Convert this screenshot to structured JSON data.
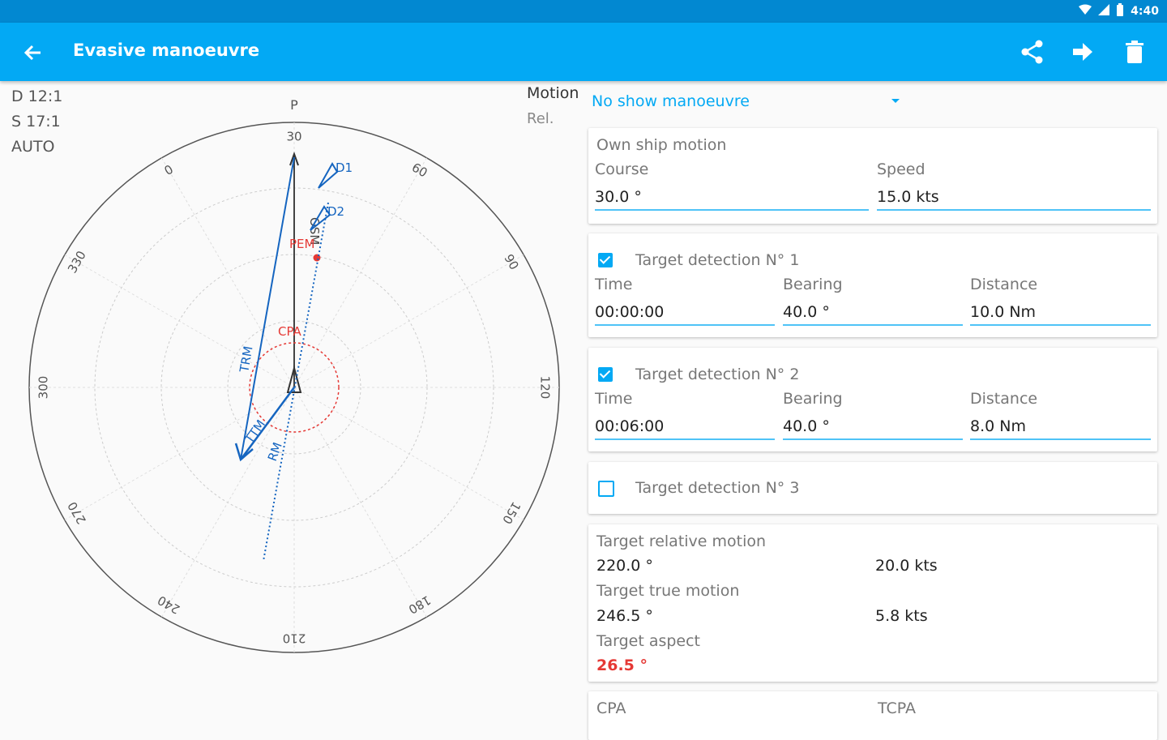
{
  "status_bar": {
    "time": "4:40"
  },
  "app_bar": {
    "title": "Evasive manoeuvre"
  },
  "scale": {
    "distance": "D 12:1",
    "speed": "S 17:1",
    "mode": "AUTO"
  },
  "motion": {
    "label": "Motion",
    "sub": "Rel.",
    "dropdown_value": "No show manoeuvre"
  },
  "own_ship": {
    "header": "Own ship motion",
    "course_label": "Course",
    "course_value": "30.0 °",
    "speed_label": "Speed",
    "speed_value": "15.0 kts"
  },
  "detections": [
    {
      "title": "Target detection N° 1",
      "checked": true,
      "time_label": "Time",
      "time": "00:00:00",
      "bearing_label": "Bearing",
      "bearing": "40.0 °",
      "distance_label": "Distance",
      "distance": "10.0 Nm"
    },
    {
      "title": "Target detection N° 2",
      "checked": true,
      "time_label": "Time",
      "time": "00:06:00",
      "bearing_label": "Bearing",
      "bearing": "40.0 °",
      "distance_label": "Distance",
      "distance": "8.0 Nm"
    },
    {
      "title": "Target detection N° 3",
      "checked": false
    }
  ],
  "results": {
    "rel_label": "Target relative motion",
    "rel_course": "220.0 °",
    "rel_speed": "20.0 kts",
    "true_label": "Target true motion",
    "true_course": "246.5 °",
    "true_speed": "5.8 kts",
    "aspect_label": "Target aspect",
    "aspect_value": "26.5 °"
  },
  "cpa": {
    "cpa_label": "CPA",
    "tcpa_label": "TCPA"
  },
  "plot": {
    "heading_mark": "P",
    "degree_labels": [
      "30",
      "60",
      "90",
      "120",
      "150",
      "180",
      "210",
      "240",
      "270",
      "300",
      "330",
      "0"
    ],
    "vector_labels": {
      "d1": "D1",
      "d2": "D2",
      "pem": "PEM",
      "cpa": "CPA",
      "trm": "TRM",
      "ttm": "TTM",
      "rm": "RM",
      "osm": "OSM"
    }
  },
  "colors": {
    "accent": "#03a9f4",
    "status": "#0288d1",
    "vector": "#1565c0",
    "alert": "#e53935"
  }
}
